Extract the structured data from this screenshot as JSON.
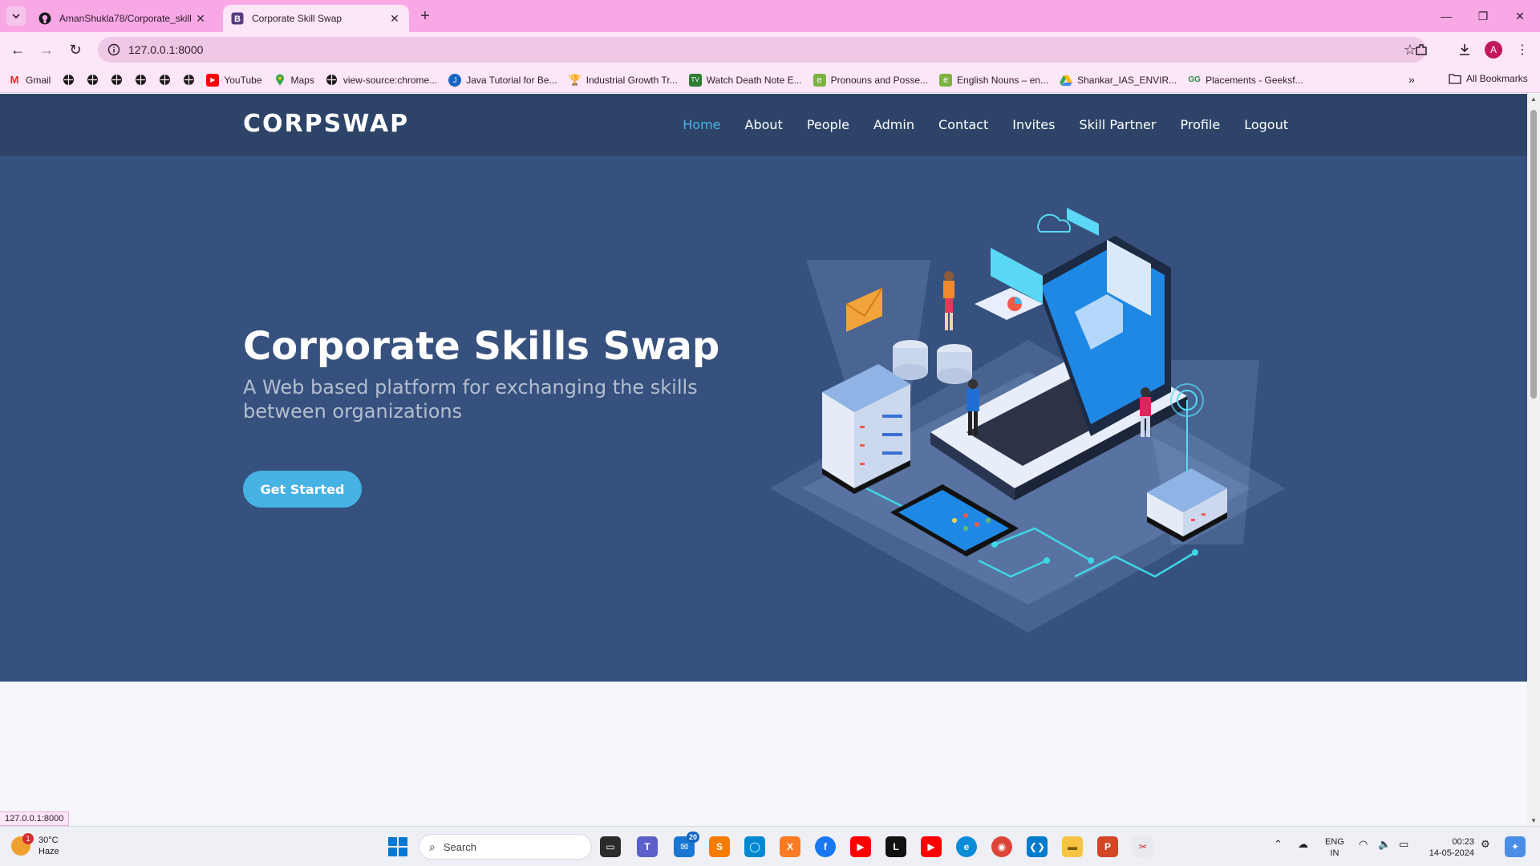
{
  "browser": {
    "tabs": [
      {
        "title": "AmanShukla78/Corporate_skill",
        "active": false
      },
      {
        "title": "Corporate Skill Swap",
        "active": true
      }
    ],
    "new_tab": "+",
    "url": "127.0.0.1:8000",
    "avatar_letter": "A",
    "bookmarks": [
      {
        "label": "Gmail",
        "icon": "gmail-icon",
        "color": "#d93025"
      },
      {
        "label": "",
        "icon": "globe-icon",
        "color": "#222222"
      },
      {
        "label": "",
        "icon": "globe-icon",
        "color": "#222222"
      },
      {
        "label": "",
        "icon": "globe-icon",
        "color": "#222222"
      },
      {
        "label": "",
        "icon": "globe-icon",
        "color": "#222222"
      },
      {
        "label": "",
        "icon": "globe-icon",
        "color": "#222222"
      },
      {
        "label": "",
        "icon": "globe-icon",
        "color": "#222222"
      },
      {
        "label": "YouTube",
        "icon": "youtube-icon",
        "color": "#ff0000"
      },
      {
        "label": "Maps",
        "icon": "maps-icon",
        "color": "#34a853"
      },
      {
        "label": "view-source:chrome...",
        "icon": "globe-icon",
        "color": "#222222"
      },
      {
        "label": "Java Tutorial for Be...",
        "icon": "java-icon",
        "color": "#1565c0"
      },
      {
        "label": "Industrial Growth Tr...",
        "icon": "trophy-icon",
        "color": "#c9871a"
      },
      {
        "label": "Watch Death Note E...",
        "icon": "shield-icon",
        "color": "#2e7d32"
      },
      {
        "label": "Pronouns and Posse...",
        "icon": "e-icon",
        "color": "#7cb342"
      },
      {
        "label": "English Nouns – en...",
        "icon": "e-icon",
        "color": "#7cb342"
      },
      {
        "label": "Shankar_IAS_ENVIR...",
        "icon": "drive-icon",
        "color": "#fbbc04"
      },
      {
        "label": "Placements - Geeksf...",
        "icon": "gfg-icon",
        "color": "#2f8d46"
      }
    ],
    "all_bookmarks": "All Bookmarks",
    "status_url": "127.0.0.1:8000"
  },
  "site": {
    "logo": "CORPSWAP",
    "nav": [
      {
        "label": "Home",
        "active": true
      },
      {
        "label": "About"
      },
      {
        "label": "People"
      },
      {
        "label": "Admin"
      },
      {
        "label": "Contact"
      },
      {
        "label": "Invites"
      },
      {
        "label": "Skill Partner"
      },
      {
        "label": "Profile"
      },
      {
        "label": "Logout"
      }
    ],
    "hero": {
      "title": "Corporate Skills Swap",
      "subtitle": "A Web based platform for exchanging the skills between organizations",
      "cta": "Get Started"
    },
    "colors": {
      "navbar": "#2d4468",
      "hero": "#37517e",
      "accent": "#47b2e4"
    }
  },
  "taskbar": {
    "weather": {
      "temp": "30°C",
      "condition": "Haze",
      "badge": "1"
    },
    "search_placeholder": "Search",
    "mail_count": "20",
    "lang": {
      "line1": "ENG",
      "line2": "IN"
    },
    "clock": {
      "time": "00:23",
      "date": "14-05-2024"
    }
  }
}
